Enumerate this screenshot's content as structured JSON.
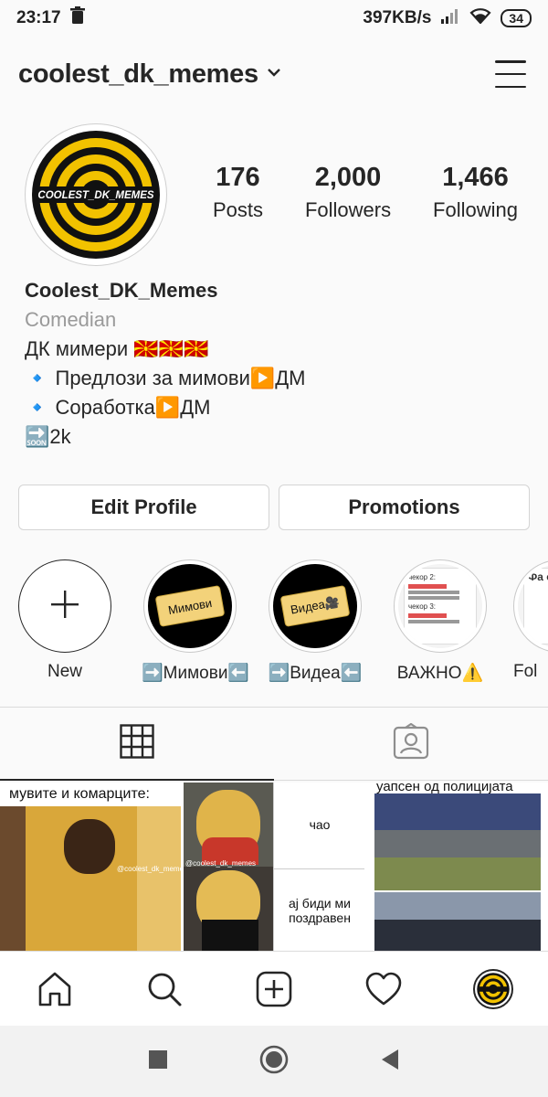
{
  "status_bar": {
    "time": "23:17",
    "net_speed": "397KB/s",
    "battery": "34"
  },
  "header": {
    "username": "coolest_dk_memes"
  },
  "avatar": {
    "logo_text": "COOLEST_DK_MEMES"
  },
  "stats": {
    "posts_count": "176",
    "posts_label": "Posts",
    "followers_count": "2,000",
    "followers_label": "Followers",
    "following_count": "1,466",
    "following_label": "Following"
  },
  "bio": {
    "name": "Coolest_DK_Memes",
    "category": "Comedian",
    "line1": "ДК мимери 🇲🇰🇲🇰🇲🇰",
    "line2": "🔹 Предлози за мимови▶️ДМ",
    "line3": "🔹 Соработка▶️ДМ",
    "line4": "🔜2k"
  },
  "buttons": {
    "edit_profile": "Edit Profile",
    "promotions": "Promotions"
  },
  "highlights": [
    {
      "label": "New"
    },
    {
      "label": "➡️Мимови⬅️",
      "tag": "Мимови"
    },
    {
      "label": "➡️Видеа⬅️",
      "tag": "Видеа🎥"
    },
    {
      "label": "ВАЖНО⚠️",
      "doc_line1": "чекор 2:",
      "doc_line2": "чекор 3:"
    },
    {
      "label": "Fol",
      "doc_text": "Фа сл"
    }
  ],
  "grid": {
    "post1_caption": "мувите и комарците:",
    "post1_watermark": "@coolest_dk_memes",
    "post2_watermark": "@coolest_dk_memes",
    "post2_text_top": "чао",
    "post2_text_bottom": "ај биди ми поздравен",
    "post3_caption": "уапсен од полицијата"
  },
  "colors": {
    "text": "#262626",
    "muted": "#9a9a9a",
    "border": "#dbdbdb",
    "logo_yellow": "#f2c200"
  }
}
